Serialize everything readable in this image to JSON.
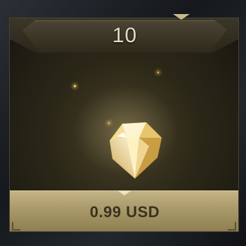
{
  "offer": {
    "quantity": "10",
    "price": "0.99 USD",
    "item_icon": "diamond-icon"
  },
  "colors": {
    "accent_gold": "#c3b385",
    "quantity_text": "#e4dcc6",
    "price_text": "#3a3220"
  }
}
